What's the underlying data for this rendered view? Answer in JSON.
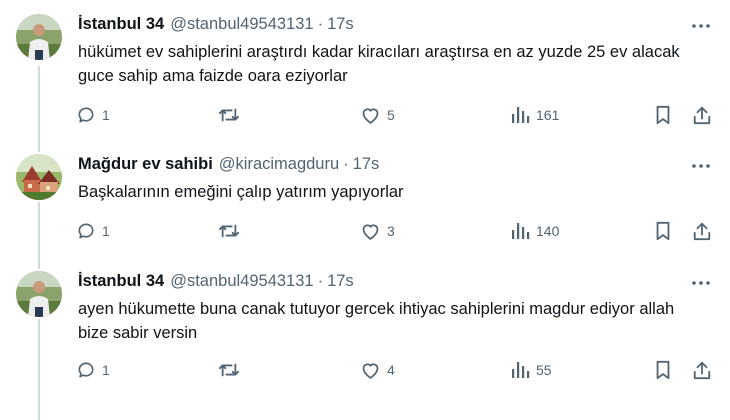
{
  "tweets": [
    {
      "name": "İstanbul 34",
      "handle": "@stanbul49543131",
      "separator": "·",
      "time": "17s",
      "text": "hükümet ev sahiplerini araştırdı kadar kiracıları araştırsa en az yuzde 25 ev alacak guce sahip ama faizde oara eziyorlar",
      "replies": "1",
      "retweets": "",
      "likes": "5",
      "views": "161",
      "avatar": "man-outdoors-avatar"
    },
    {
      "name": "Mağdur ev sahibi",
      "handle": "@kiracimagduru",
      "separator": "·",
      "time": "17s",
      "text": "Başkalarının emeğini çalıp yatırım yapıyorlar",
      "replies": "1",
      "retweets": "",
      "likes": "3",
      "views": "140",
      "avatar": "houses-avatar"
    },
    {
      "name": "İstanbul 34",
      "handle": "@stanbul49543131",
      "separator": "·",
      "time": "17s",
      "text": "ayen hükumette buna canak tutuyor gercek ihtiyac sahiplerini magdur ediyor allah bize sabir versin",
      "replies": "1",
      "retweets": "",
      "likes": "4",
      "views": "55",
      "avatar": "man-outdoors-avatar"
    }
  ],
  "icons": {
    "reply": "reply-icon",
    "retweet": "retweet-icon",
    "like": "heart-icon",
    "views": "views-icon",
    "bookmark": "bookmark-icon",
    "share": "share-icon",
    "more": "more-icon"
  },
  "colors": {
    "text": "#0f1419",
    "secondary": "#536471",
    "thread_line": "#cfd9de"
  }
}
